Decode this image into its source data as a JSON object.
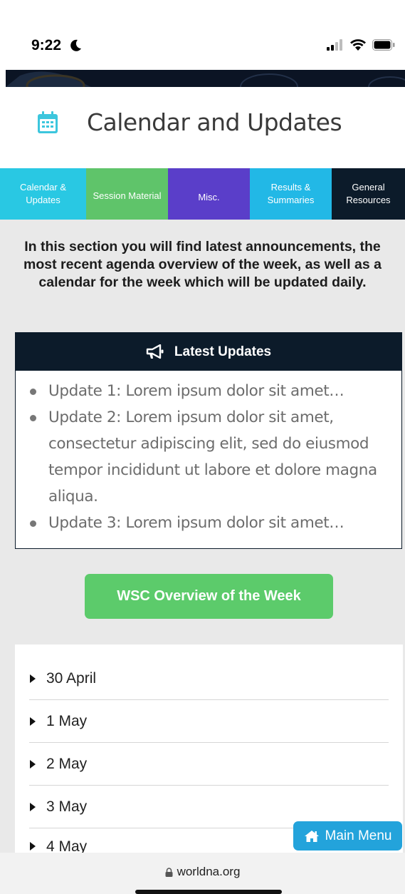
{
  "status_bar": {
    "time": "9:22",
    "icons": [
      "moon-icon",
      "signal-icon",
      "wifi-icon",
      "battery-icon"
    ]
  },
  "header": {
    "icon": "calendar-icon",
    "title": "Calendar and Updates"
  },
  "nav": {
    "tabs": [
      {
        "label": "Calendar & Updates",
        "color": "#29c8e3"
      },
      {
        "label": "Session Material",
        "color": "#5fc46a"
      },
      {
        "label": "Misc.",
        "color": "#5a3ec9"
      },
      {
        "label": "Results & Summaries",
        "color": "#22b8e6"
      },
      {
        "label": "General Resources",
        "color": "#0c1b2a"
      }
    ]
  },
  "intro": "In this section you will find latest announcements, the most recent agenda overview of the week, as well as a calendar for the week which will be updated daily.",
  "updates": {
    "icon": "megaphone-icon",
    "title": "Latest Updates",
    "items": [
      "Update 1: Lorem ipsum dolor sit amet…",
      "Update 2:  Lorem ipsum dolor sit amet, consectetur adipiscing elit, sed do eiusmod tempor incididunt ut labore et dolore magna aliqua.",
      "Update 3: Lorem ipsum dolor sit amet…"
    ]
  },
  "overview_button": "WSC Overview of the Week",
  "dates": [
    "30 April",
    "1 May",
    "2 May",
    "3 May",
    "4 May"
  ],
  "main_menu": {
    "icon": "home-icon",
    "label": "Main Menu"
  },
  "browser": {
    "icon": "lock-icon",
    "url": "worldna.org"
  },
  "colors": {
    "dark_navy": "#0c1b2a",
    "green": "#5ccb6b",
    "cyan": "#29c8e3",
    "blue": "#23a3db",
    "purple": "#5a3ec9"
  }
}
